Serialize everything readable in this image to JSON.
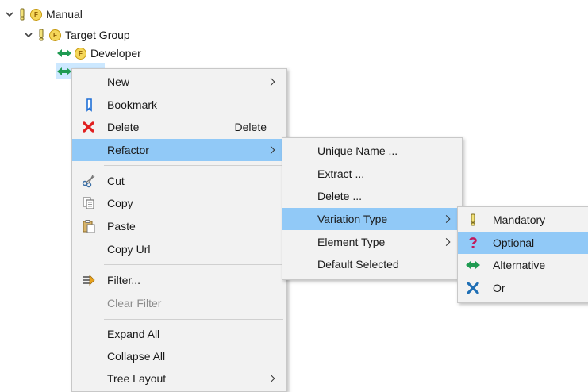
{
  "tree": {
    "nodes": [
      {
        "label": "Manual"
      },
      {
        "label": "Target Group"
      },
      {
        "label": "Developer"
      },
      {
        "label": ""
      }
    ]
  },
  "context_menu": {
    "items": {
      "new": "New",
      "bookmark": "Bookmark",
      "delete": "Delete",
      "delete_accel": "Delete",
      "refactor": "Refactor",
      "cut": "Cut",
      "copy": "Copy",
      "paste": "Paste",
      "copy_url": "Copy Url",
      "filter": "Filter...",
      "clear_filter": "Clear Filter",
      "expand_all": "Expand All",
      "collapse_all": "Collapse All",
      "tree_layout": "Tree Layout"
    }
  },
  "refactor_menu": {
    "items": {
      "unique_name": "Unique Name ...",
      "extract": "Extract ...",
      "delete": "Delete ...",
      "variation_type": "Variation Type",
      "element_type": "Element Type",
      "default_selected": "Default Selected"
    }
  },
  "variation_menu": {
    "items": {
      "mandatory": "Mandatory",
      "optional": "Optional",
      "alternative": "Alternative",
      "or": "Or"
    }
  },
  "colors": {
    "highlight": "#91c9f7",
    "menu_bg": "#f2f2f2",
    "feature_badge": "#f5d75a",
    "alternative_icon": "#1f9b52",
    "delete_icon": "#e02020",
    "or_icon": "#1f6fb5"
  }
}
